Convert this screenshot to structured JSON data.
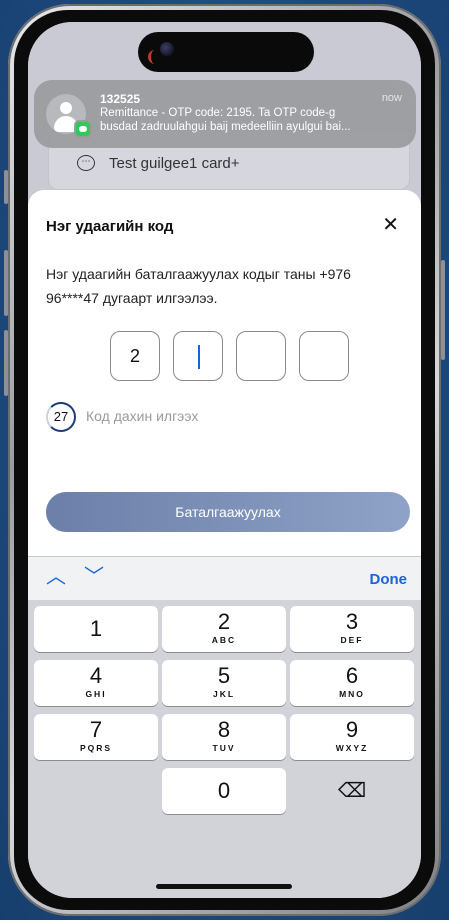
{
  "notification": {
    "sender": "132525",
    "time": "now",
    "line1": "Remittance - OTP code: 2195. Ta OTP code-g",
    "line2": "busdad zadruulahgui baij medeelliin ayulgui bai..."
  },
  "background_card": {
    "label": "Test guilgee1 card+"
  },
  "otp_sheet": {
    "title": "Нэг удаагийн код",
    "close_symbol": "✕",
    "description": "Нэг удаагийн баталгаажуулах кодыг таны +976 96****47 дугаарт илгээлээ.",
    "digits": [
      "2",
      "",
      "",
      ""
    ],
    "timer_value": "27",
    "resend_label": "Код дахин илгээх",
    "confirm_label": "Баталгаажуулах"
  },
  "keyboard": {
    "up_symbol": "︿",
    "down_symbol": "﹀",
    "done_label": "Done",
    "keys": [
      {
        "num": "1",
        "letters": ""
      },
      {
        "num": "2",
        "letters": "ABC"
      },
      {
        "num": "3",
        "letters": "DEF"
      },
      {
        "num": "4",
        "letters": "GHI"
      },
      {
        "num": "5",
        "letters": "JKL"
      },
      {
        "num": "6",
        "letters": "MNO"
      },
      {
        "num": "7",
        "letters": "PQRS"
      },
      {
        "num": "8",
        "letters": "TUV"
      },
      {
        "num": "9",
        "letters": "WXYZ"
      },
      {
        "num": "0",
        "letters": ""
      }
    ],
    "backspace_symbol": "⌫"
  },
  "colors": {
    "accent": "#1a63d9",
    "button_start": "#6b7fa8",
    "button_end": "#8fa3c8",
    "timer_ring": "#1b3c78"
  }
}
